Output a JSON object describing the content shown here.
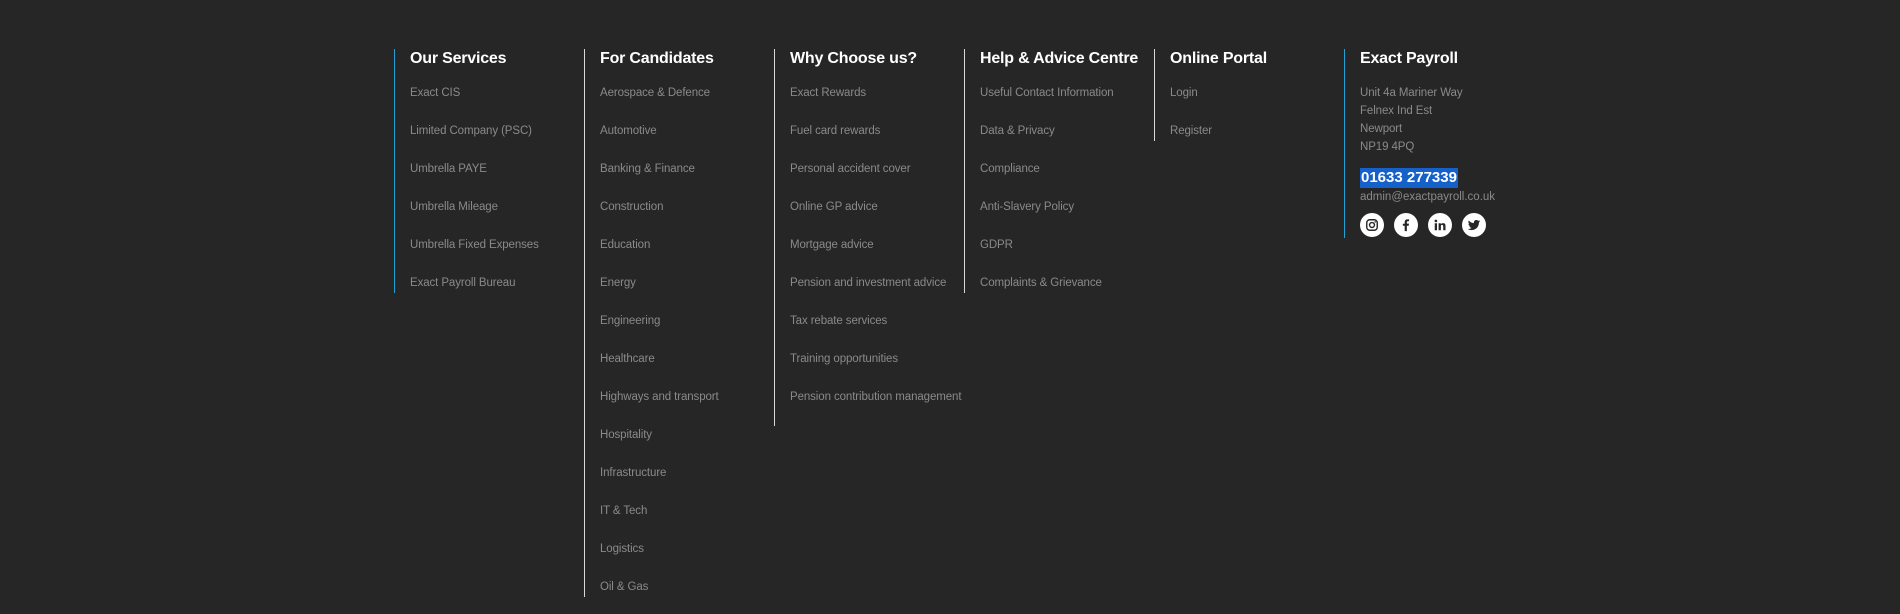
{
  "colors": {
    "background": "#262626",
    "accent_border": "#1fa3d6",
    "divider": "#d8d8d8",
    "link_text": "#8a8a8a",
    "heading_text": "#ffffff",
    "phone_highlight": "#1560c9"
  },
  "services": {
    "title": "Our Services",
    "links": [
      "Exact CIS",
      "Limited Company (PSC)",
      "Umbrella PAYE",
      "Umbrella Mileage",
      "Umbrella Fixed Expenses",
      "Exact Payroll Bureau"
    ]
  },
  "candidates": {
    "title": "For Candidates",
    "links": [
      "Aerospace & Defence",
      "Automotive",
      "Banking & Finance",
      "Construction",
      "Education",
      "Energy",
      "Engineering",
      "Healthcare",
      "Highways and transport",
      "Hospitality",
      "Infrastructure",
      "IT & Tech",
      "Logistics",
      "Oil & Gas"
    ]
  },
  "why": {
    "title": "Why Choose us?",
    "links": [
      "Exact Rewards",
      "Fuel card rewards",
      "Personal accident cover",
      "Online GP advice",
      "Mortgage advice",
      "Pension and investment advice",
      "Tax rebate services",
      "Training opportunities",
      "Pension contribution management"
    ]
  },
  "help": {
    "title": "Help & Advice Centre",
    "links": [
      "Useful Contact Information",
      "Data & Privacy",
      "Compliance",
      "Anti-Slavery Policy",
      "GDPR",
      "Complaints & Grievance"
    ]
  },
  "portal": {
    "title": "Online Portal",
    "links": [
      "Login",
      "Register"
    ]
  },
  "company": {
    "title": "Exact Payroll",
    "address": [
      "Unit 4a Mariner Way",
      "Felnex Ind Est",
      "Newport",
      "NP19 4PQ"
    ],
    "phone": "01633 277339",
    "email": "admin@exactpayroll.co.uk",
    "socials": [
      "instagram-icon",
      "facebook-icon",
      "linkedin-icon",
      "twitter-icon"
    ]
  }
}
